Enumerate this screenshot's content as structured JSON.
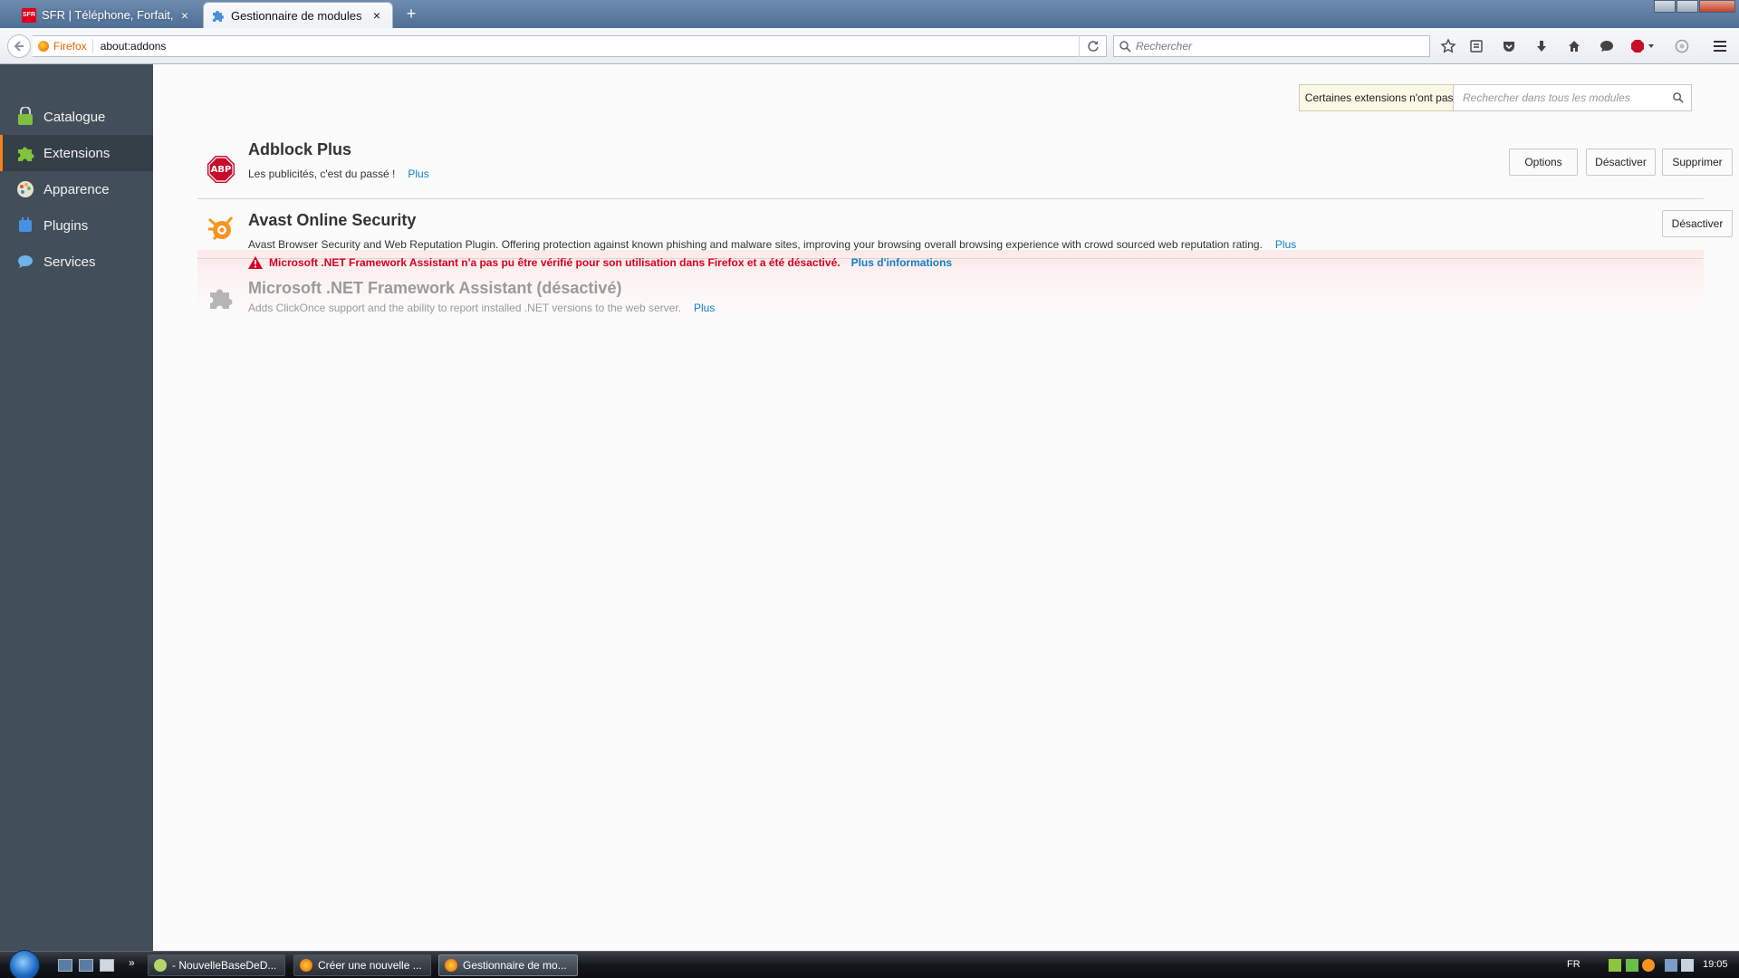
{
  "tabs": [
    {
      "title": "SFR | Téléphone, Forfait, Of...",
      "favicon": "sfr-logo",
      "logo_text": "SFR",
      "close": "×"
    },
    {
      "title": "Gestionnaire de modules c...",
      "favicon": "puzzle-icon",
      "close": "×"
    }
  ],
  "new_tab": "+",
  "navbar": {
    "identity_label": "Firefox",
    "url": "about:addons",
    "search_placeholder": "Rechercher"
  },
  "sidebar": {
    "items": [
      {
        "label": "Catalogue",
        "icon": "catalogue-icon"
      },
      {
        "label": "Extensions",
        "icon": "puzzle-icon",
        "selected": true
      },
      {
        "label": "Apparence",
        "icon": "palette-icon"
      },
      {
        "label": "Plugins",
        "icon": "plugin-icon"
      },
      {
        "label": "Services",
        "icon": "services-icon"
      }
    ]
  },
  "header": {
    "verify_notice": "Certaines extensions n'ont pas pu être vérifiées",
    "search_placeholder": "Rechercher dans tous les modules"
  },
  "addons": [
    {
      "name": "Adblock Plus",
      "icon_text": "ABP",
      "description": "Les publicités, c'est du passé !",
      "more": "Plus",
      "buttons": [
        "Options",
        "Désactiver",
        "Supprimer"
      ]
    },
    {
      "name": "Avast Online Security",
      "description": "Avast Browser Security and Web Reputation Plugin. Offering protection against known phishing and malware sites, improving your browsing overall browsing experience with crowd sourced web reputation rating.",
      "more": "Plus",
      "buttons": [
        "Désactiver"
      ]
    },
    {
      "warning": "Microsoft .NET Framework Assistant n'a pas pu être vérifié pour son utilisation dans Firefox et a été désactivé.",
      "warning_link": "Plus d'informations",
      "name": "Microsoft .NET Framework Assistant  (désactivé)",
      "description": "Adds ClickOnce support and the ability to report installed .NET versions to the web server.",
      "more": "Plus"
    }
  ],
  "taskbar": {
    "more": "»",
    "tasks": [
      {
        "label": "- NouvelleBaseDeD..."
      },
      {
        "label": "Créer une nouvelle ..."
      },
      {
        "label": "Gestionnaire de mo..."
      }
    ],
    "language": "FR",
    "clock": "19:05"
  },
  "colors": {
    "sidebar_bg": "#424f5a",
    "sidebar_selected_accent": "#f7801c",
    "link": "#0f7ec4",
    "warning": "#d70022"
  }
}
